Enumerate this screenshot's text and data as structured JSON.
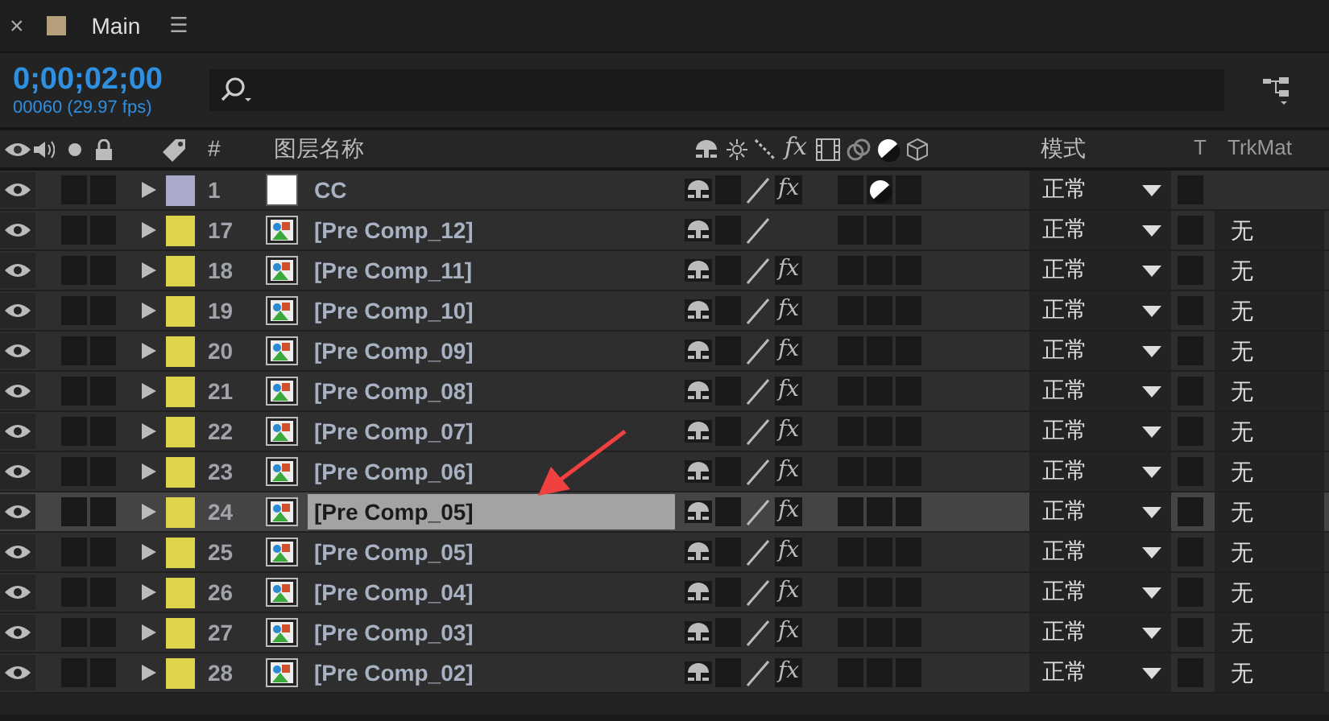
{
  "tab": {
    "title": "Main",
    "close": "×",
    "menu": "☰"
  },
  "timecode": "0;00;02;00",
  "frames": "00060 (29.97 fps)",
  "columns": {
    "number": "#",
    "name": "图层名称",
    "fx": "fx",
    "mode": "模式",
    "t": "T",
    "trkmat": "TrkMat"
  },
  "rows": [
    {
      "number": "1",
      "name": "CC",
      "kind": "solid",
      "color": "#a9a9c9",
      "fx": "fx",
      "adjustment": true,
      "selected": false,
      "editing": false,
      "mode": "正常"
    },
    {
      "number": "17",
      "name": "[Pre Comp_12]",
      "kind": "comp",
      "color": "#e0d44a",
      "adjustment": false,
      "selected": false,
      "editing": false,
      "mode": "正常",
      "trkmat": "无"
    },
    {
      "number": "18",
      "name": "[Pre Comp_11]",
      "kind": "comp",
      "color": "#e0d44a",
      "fx": "fx",
      "adjustment": false,
      "selected": false,
      "editing": false,
      "mode": "正常",
      "trkmat": "无"
    },
    {
      "number": "19",
      "name": "[Pre Comp_10]",
      "kind": "comp",
      "color": "#e0d44a",
      "fx": "fx",
      "adjustment": false,
      "selected": false,
      "editing": false,
      "mode": "正常",
      "trkmat": "无"
    },
    {
      "number": "20",
      "name": "[Pre Comp_09]",
      "kind": "comp",
      "color": "#e0d44a",
      "fx": "fx",
      "adjustment": false,
      "selected": false,
      "editing": false,
      "mode": "正常",
      "trkmat": "无"
    },
    {
      "number": "21",
      "name": "[Pre Comp_08]",
      "kind": "comp",
      "color": "#e0d44a",
      "fx": "fx",
      "adjustment": false,
      "selected": false,
      "editing": false,
      "mode": "正常",
      "trkmat": "无"
    },
    {
      "number": "22",
      "name": "[Pre Comp_07]",
      "kind": "comp",
      "color": "#e0d44a",
      "fx": "fx",
      "adjustment": false,
      "selected": false,
      "editing": false,
      "mode": "正常",
      "trkmat": "无"
    },
    {
      "number": "23",
      "name": "[Pre Comp_06]",
      "kind": "comp",
      "color": "#e0d44a",
      "fx": "fx",
      "adjustment": false,
      "selected": false,
      "editing": false,
      "mode": "正常",
      "trkmat": "无"
    },
    {
      "number": "24",
      "name": "[Pre Comp_05]",
      "kind": "comp",
      "color": "#e0d44a",
      "fx": "fx",
      "adjustment": false,
      "selected": true,
      "editing": true,
      "mode": "正常",
      "trkmat": "无"
    },
    {
      "number": "25",
      "name": "[Pre Comp_05]",
      "kind": "comp",
      "color": "#e0d44a",
      "fx": "fx",
      "adjustment": false,
      "selected": false,
      "editing": false,
      "mode": "正常",
      "trkmat": "无"
    },
    {
      "number": "26",
      "name": "[Pre Comp_04]",
      "kind": "comp",
      "color": "#e0d44a",
      "fx": "fx",
      "adjustment": false,
      "selected": false,
      "editing": false,
      "mode": "正常",
      "trkmat": "无"
    },
    {
      "number": "27",
      "name": "[Pre Comp_03]",
      "kind": "comp",
      "color": "#e0d44a",
      "fx": "fx",
      "adjustment": false,
      "selected": false,
      "editing": false,
      "mode": "正常",
      "trkmat": "无"
    },
    {
      "number": "28",
      "name": "[Pre Comp_02]",
      "kind": "comp",
      "color": "#e0d44a",
      "fx": "fx",
      "adjustment": false,
      "selected": false,
      "editing": false,
      "mode": "正常",
      "trkmat": "无"
    }
  ]
}
